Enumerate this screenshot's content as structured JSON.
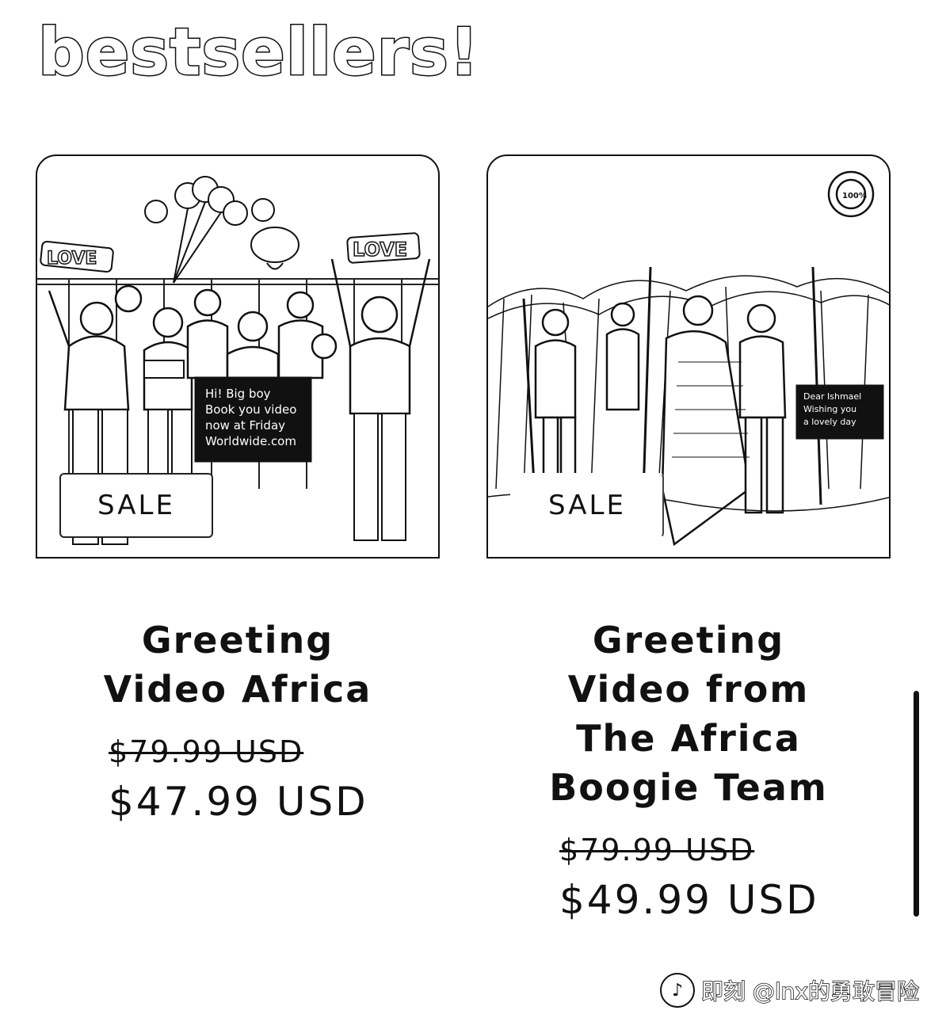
{
  "section": {
    "title": "bestsellers!"
  },
  "products": [
    {
      "badge": "SALE",
      "title": "Greeting Video Africa",
      "old_price": "$79.99 USD",
      "new_price": "$47.99 USD",
      "image_icon": "photo-group-celebration-icon"
    },
    {
      "badge": "SALE",
      "title": "Greeting Video from The Africa Boogie Team",
      "old_price": "$79.99 USD",
      "new_price": "$49.99 USD",
      "image_icon": "photo-tribal-group-icon"
    }
  ],
  "watermark": {
    "text": "即刻 @lnx的勇敢冒险"
  }
}
